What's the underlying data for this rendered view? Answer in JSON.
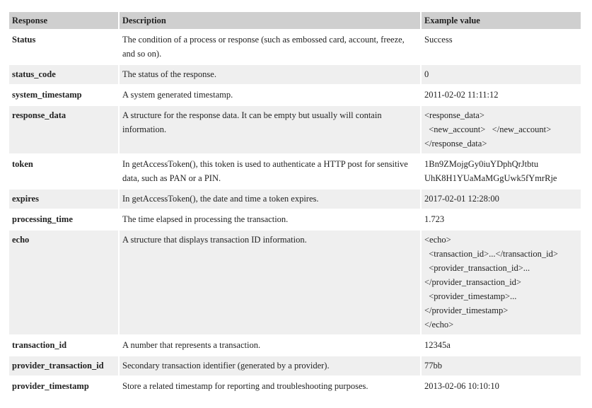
{
  "headers": [
    "Response",
    "Description",
    "Example value"
  ],
  "rows": [
    {
      "name": "Status",
      "description": "The condition of a process or response (such as embossed card, account, freeze, and so on).",
      "example": "Success"
    },
    {
      "name": "status_code",
      "description": "The status of the response.",
      "example": "0"
    },
    {
      "name": "system_timestamp",
      "description": "A system generated timestamp.",
      "example": "2011-02-02 11:11:12"
    },
    {
      "name": "response_data",
      "description": "A structure for the response data. It can be empty but usually will contain information.",
      "example": "<response_data>\n  <new_account>   </new_account>\n</response_data>"
    },
    {
      "name": "token",
      "description": "In getAccessToken(), this token is used to authenticate a HTTP post for sensitive data, such as PAN or a PIN.",
      "example": "1Bn9ZMojgGy0iuYDphQrJtbtu\nUhK8H1YUaMaMGgUwk5fYmrRje"
    },
    {
      "name": "expires",
      "description": "In getAccessToken(), the date and time a token expires.",
      "example": "2017-02-01 12:28:00"
    },
    {
      "name": "processing_time",
      "description": "The time elapsed in processing the transaction.",
      "example": "1.723"
    },
    {
      "name": "echo",
      "description": "A structure that displays transaction ID information.",
      "example": "<echo>\n  <transaction_id>...</transaction_id>\n  <provider_transaction_id>...\n</provider_transaction_id>\n  <provider_timestamp>...\n</provider_timestamp>\n</echo>"
    },
    {
      "name": "transaction_id",
      "description": "A number that represents a transaction.",
      "example": "12345a"
    },
    {
      "name": "provider_transaction_id",
      "description": "Secondary transaction identifier (generated by a provider).",
      "example": "77bb"
    },
    {
      "name": "provider_timestamp",
      "description": "Store a related timestamp for reporting and troubleshooting purposes.",
      "example": "2013-02-06 10:10:10"
    }
  ]
}
